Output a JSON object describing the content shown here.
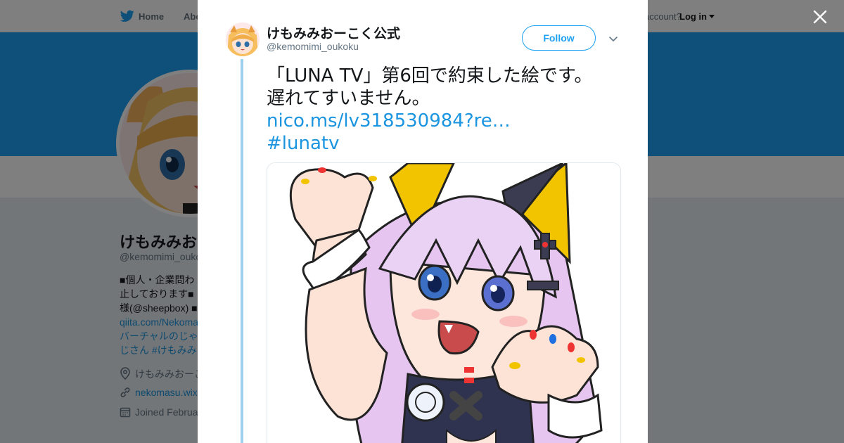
{
  "nav": {
    "home": "Home",
    "about": "Abo",
    "account_prompt": "account?",
    "login": "Log in"
  },
  "profile": {
    "name": "けもみみお",
    "handle": "@kemomimi_ouko",
    "bio_lines": [
      "■個人・企業問わ",
      "止しております■",
      "様(@sheepbox) ■",
      "qiita.com/Nekoma",
      "バーチャルのじゃ",
      "じさん #けもみみ"
    ],
    "location": "けもみみおーこ",
    "website": "nekomasu.wix",
    "joined": "Joined Februa"
  },
  "tweet": {
    "author_name": "けもみみおーこく公式",
    "author_handle": "@kemomimi_oukoku",
    "follow_label": "Follow",
    "text_line1": "「LUNA TV」第6回で約束した絵です。",
    "text_line2": "遅れてすいません。",
    "link": "nico.ms/lv318530984?re…",
    "hashtag": "#lunatv"
  },
  "colors": {
    "brand_blue": "#1da1f2",
    "link_blue": "#1b95e0",
    "thread_line": "#9ed0ee"
  },
  "icons": {
    "logo": "twitter-bird-icon",
    "close": "close-icon",
    "more": "chevron-down-icon",
    "location": "location-icon",
    "website": "link-icon",
    "joined": "calendar-icon"
  }
}
